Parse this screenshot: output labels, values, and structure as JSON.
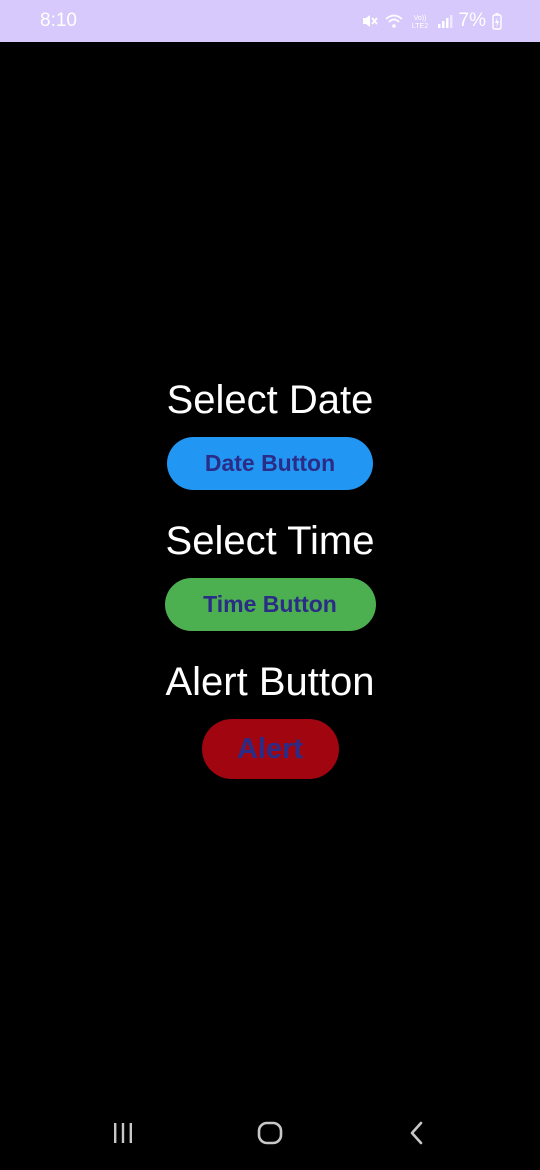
{
  "status_bar": {
    "time": "8:10",
    "battery": "7%",
    "icons": [
      "mute-icon",
      "wifi-icon",
      "volte-icon",
      "signal-icon",
      "battery-charging-icon"
    ]
  },
  "main": {
    "date_title": "Select Date",
    "date_button": "Date Button",
    "time_title": "Select Time",
    "time_button": "Time Button",
    "alert_title": "Alert Button",
    "alert_button": "Alert"
  },
  "colors": {
    "status_bar_bg": "#d7c9fb",
    "date_button_bg": "#2196f3",
    "time_button_bg": "#4caf50",
    "alert_button_bg": "#a00510",
    "button_text": "#2b2c86"
  },
  "nav_bar": {
    "icons": [
      "recent-apps-icon",
      "home-icon",
      "back-icon"
    ]
  }
}
